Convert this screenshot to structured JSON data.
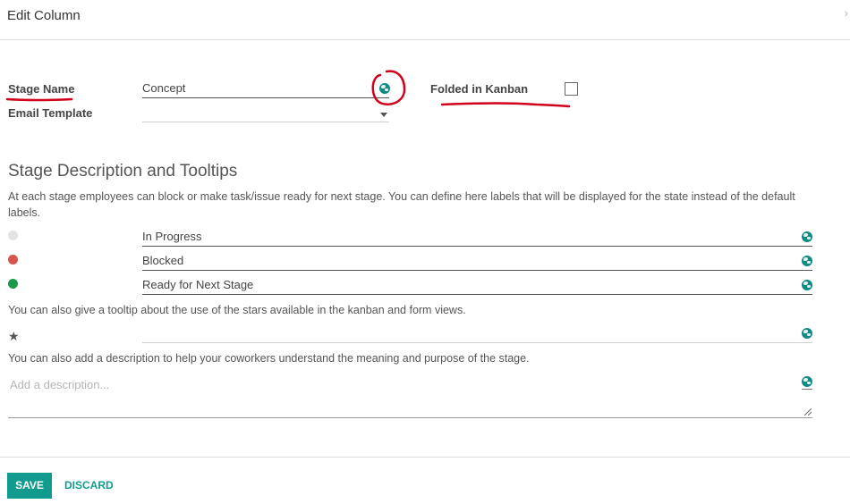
{
  "dialog": {
    "title": "Edit Column",
    "close_symbol": "›"
  },
  "form": {
    "stage_name_label": "Stage Name",
    "stage_name_value": "Concept",
    "email_template_label": "Email Template",
    "email_template_value": "",
    "folded_label": "Folded in Kanban",
    "folded_checked": false
  },
  "section": {
    "title": "Stage Description and Tooltips",
    "intro": "At each stage employees can block or make task/issue ready for next stage. You can define here labels that will be displayed for the state instead of the default labels.",
    "states": [
      {
        "value": "In Progress",
        "color": "#e3e3e3"
      },
      {
        "value": "Blocked",
        "color": "#d9534f"
      },
      {
        "value": "Ready for Next Stage",
        "color": "#1a9a4a"
      }
    ],
    "tooltip_help": "You can also give a tooltip about the use of the stars available in the kanban and form views.",
    "star_value": "",
    "description_help": "You can also add a description to help your coworkers understand the meaning and purpose of the stage.",
    "description_placeholder": "Add a description..."
  },
  "footer": {
    "save_label": "SAVE",
    "discard_label": "DISCARD"
  },
  "colors": {
    "accent": "#119b8f",
    "annotation": "#d0021b"
  },
  "icons": [
    "globe-icon",
    "star-icon",
    "caret-down-icon",
    "close-icon",
    "resize-handle-icon"
  ]
}
